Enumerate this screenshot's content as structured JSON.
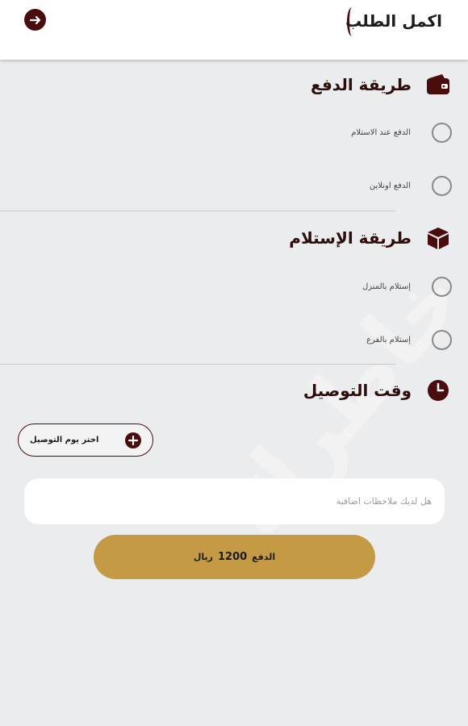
{
  "header": {
    "title": "اكمل الطلب",
    "back_icon": "arrow-right-icon"
  },
  "payment": {
    "title": "طريقة الدفع",
    "icon": "wallet-icon",
    "options": [
      {
        "label": "الدفع عند الاستلام",
        "selected": false
      },
      {
        "label": "الدفع اونلاين",
        "selected": false
      }
    ]
  },
  "receipt": {
    "title": "طريقة الإستلام",
    "icon": "box-icon",
    "options": [
      {
        "label": "إستلام بالمنزل",
        "selected": false
      },
      {
        "label": "إستلام بالفرع",
        "selected": false
      }
    ]
  },
  "delivery": {
    "title": "وقت التوصيل",
    "icon": "clock-icon",
    "date_button_label": "اختر يوم التوصيل"
  },
  "notes": {
    "placeholder": "هل لديك ملاحظات اضافية",
    "value": ""
  },
  "pay": {
    "label": "الدفع",
    "amount": "1200",
    "currency": "ريال"
  },
  "watermark": {
    "text": "علي خاطرك"
  },
  "colors": {
    "brand": "#4a0d0d",
    "pay_button": "#c49a45",
    "background": "#ebeced"
  }
}
